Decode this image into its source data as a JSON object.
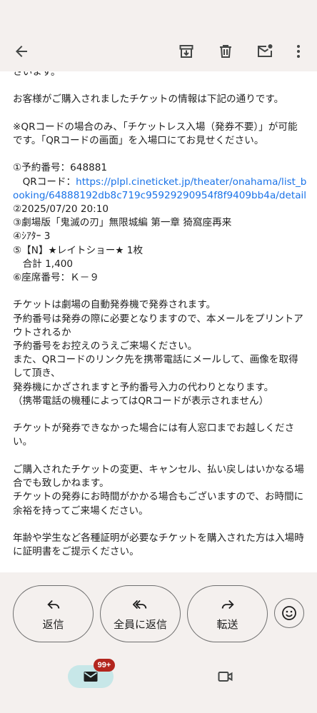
{
  "toolbar": {
    "back_icon": "arrow-left-icon",
    "archive_icon": "archive-icon",
    "delete_icon": "trash-icon",
    "mark_unread_icon": "mark-unread-icon",
    "more_icon": "more-vert-icon"
  },
  "email": {
    "lines": [
      "さいます。",
      "",
      "お客様がご購入されましたチケットの情報は下記の通りです。",
      "",
      "※QRコードの場合のみ、「チケットレス入場（発券不要）」が可能です。「QRコードの画面」を入場口にてお見せください。",
      "",
      "①予約番号：648881",
      "　QRコード："
    ],
    "link": "https://plpl.cineticket.jp/theater/onahama/list_booking/64888192db8c719c95929290954f8f9409bb4a/detail",
    "lines_after": [
      "②2025/07/20 20:10",
      "③劇場版「鬼滅の刃」無限城編 第一章 猗窩座再来",
      "④ｼｱﾀｰ 3",
      "⑤【N】★レイトショー★ 1枚",
      "　合計 1,400",
      "⑥座席番号：Ｋ－９",
      "",
      "チケットは劇場の自動発券機で発券されます。",
      "予約番号は発券の際に必要となりますので、本メールをプリントアウトされるか",
      "予約番号をお控えのうえご来場ください。",
      "また、QRコードのリンク先を携帯電話にメールして、画像を取得して頂き、",
      "発券機にかざされますと予約番号入力の代わりとなります。",
      "（携帯電話の機種によってはQRコードが表示されません）",
      "",
      "チケットが発券できなかった場合には有人窓口までお越しください。",
      "",
      "ご購入されたチケットの変更、キャンセル、払い戻しはいかなる場合でも致しかねます。",
      "チケットの発券にお時間がかかる場合もございますので、お時間に余裕を持ってご来場ください。",
      "",
      "年齢や学生など各種証明が必要なチケットを購入された方は入場時に証明書をご提示ください。"
    ]
  },
  "actions": {
    "reply_label": "返信",
    "reply_all_label": "全員に返信",
    "forward_label": "転送"
  },
  "nav": {
    "mail_badge": "99+"
  }
}
